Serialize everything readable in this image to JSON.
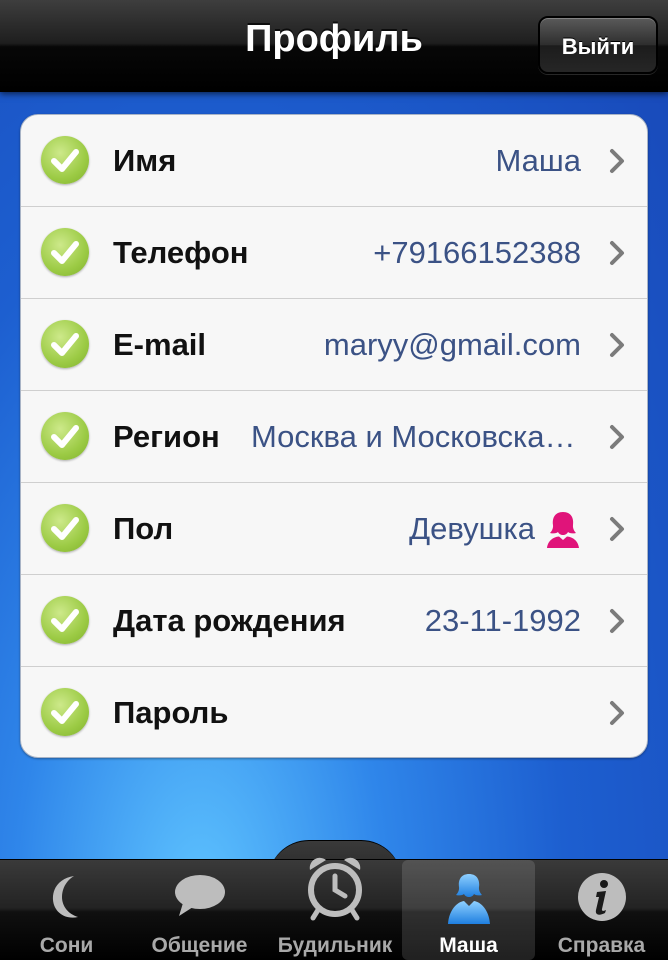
{
  "header": {
    "title": "Профиль",
    "logout_label": "Выйти"
  },
  "profile": {
    "rows": [
      {
        "label": "Имя",
        "value": "Маша"
      },
      {
        "label": "Телефон",
        "value": "+79166152388"
      },
      {
        "label": "E-mail",
        "value": "maryy@gmail.com"
      },
      {
        "label": "Регион",
        "value": "Москва и Московская область"
      },
      {
        "label": "Пол",
        "value": "Девушка",
        "icon": "female-icon"
      },
      {
        "label": "Дата рождения",
        "value": "23-11-1992"
      },
      {
        "label": "Пароль",
        "value": ""
      }
    ]
  },
  "tabbar": {
    "tabs": [
      {
        "label": "Сони",
        "icon": "moon-icon",
        "active": false
      },
      {
        "label": "Общение",
        "icon": "speech-bubble-icon",
        "active": false
      },
      {
        "label": "Будильник",
        "icon": "alarm-clock-icon",
        "active": false
      },
      {
        "label": "Маша",
        "icon": "user-icon",
        "active": true
      },
      {
        "label": "Справка",
        "icon": "info-icon",
        "active": false
      }
    ]
  },
  "colors": {
    "accent_check": "#9ccb45",
    "value_text": "#3b5285",
    "female_icon": "#e0147a",
    "background_blue": "#1d5fd0"
  }
}
